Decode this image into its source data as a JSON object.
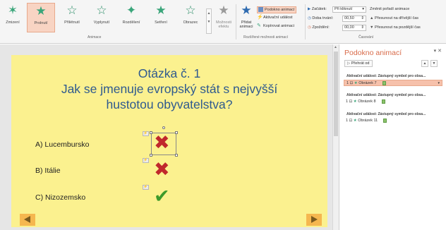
{
  "ribbon": {
    "effects": [
      {
        "label": "Zmizení"
      },
      {
        "label": "Prolnutí"
      },
      {
        "label": "Přilétnutí"
      },
      {
        "label": "Vyplynutí"
      },
      {
        "label": "Rozdělení"
      },
      {
        "label": "Setření"
      },
      {
        "label": "Obrazec"
      }
    ],
    "effect_options": "Možnosti efektu",
    "groups": {
      "animation": "Animace",
      "advanced": "Rozšířené možnosti animací",
      "timing": "Časování"
    },
    "add_animation": "Přidat animaci",
    "advanced_cmds": {
      "pane": "Podokno animací",
      "trigger": "Aktivační událost",
      "copy": "Kopírovat animaci"
    },
    "timing": {
      "start_label": "Začátek:",
      "start_value": "Při kliknutí",
      "duration_label": "Doba trvání:",
      "duration_value": "00,50",
      "delay_label": "Zpoždění:",
      "delay_value": "00,00",
      "reorder_title": "Změnit pořadí animace",
      "move_earlier": "Přesunout na dřívější čas",
      "move_later": "Přesunout na pozdější čas"
    }
  },
  "slide": {
    "title_line1": "Otázka č. 1",
    "title_line2": "Jak se jmenuje evropský stát s nejvyšší",
    "title_line3": "hustotou obyvatelstva?",
    "answers": [
      {
        "text": "A) Lucembursko",
        "mark": "✖"
      },
      {
        "text": "B) Itálie",
        "mark": "✖"
      },
      {
        "text": "C) Nizozemsko",
        "mark": "✔"
      }
    ]
  },
  "pane": {
    "title": "Podokno animací",
    "play_label": "Přehrát od",
    "items": [
      {
        "trigger": "Aktivační událost: Zástupný symbol pro obsa...",
        "label": "Obrázek 7",
        "num": "1"
      },
      {
        "trigger": "Aktivační událost: Zástupný symbol pro obsa...",
        "label": "Obrázek 8",
        "num": "1"
      },
      {
        "trigger": "Aktivační událost: Zástupný symbol pro obsa...",
        "label": "Obrázek 11",
        "num": "1"
      }
    ]
  },
  "colors": {
    "accent": "#d86b4a",
    "slide_bg": "#fbf18f",
    "title": "#2f5a8f",
    "selected": "#f8d4c3"
  }
}
